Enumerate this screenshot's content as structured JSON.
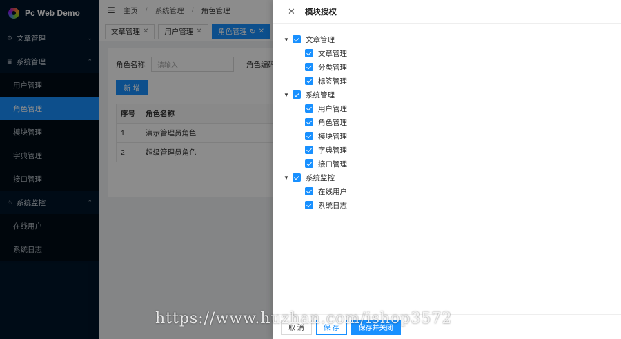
{
  "app": {
    "title": "Pc Web Demo"
  },
  "sidebar": {
    "groups": [
      {
        "label": "文章管理",
        "icon": "article-icon",
        "expanded": false,
        "items": []
      },
      {
        "label": "系统管理",
        "icon": "settings-icon",
        "expanded": true,
        "items": [
          {
            "label": "用户管理",
            "active": false
          },
          {
            "label": "角色管理",
            "active": true
          },
          {
            "label": "模块管理",
            "active": false
          },
          {
            "label": "字典管理",
            "active": false
          },
          {
            "label": "接口管理",
            "active": false
          }
        ]
      },
      {
        "label": "系统监控",
        "icon": "monitor-icon",
        "expanded": true,
        "items": [
          {
            "label": "在线用户",
            "active": false
          },
          {
            "label": "系统日志",
            "active": false
          }
        ]
      }
    ]
  },
  "header": {
    "breadcrumb": [
      "主页",
      "系统管理",
      "角色管理"
    ]
  },
  "tabs": [
    {
      "label": "文章管理",
      "active": false
    },
    {
      "label": "用户管理",
      "active": false
    },
    {
      "label": "角色管理",
      "active": true
    }
  ],
  "search": {
    "role_name_label": "角色名称:",
    "role_name_placeholder": "请输入",
    "role_code_label": "角色编码:"
  },
  "add_button": "新 增",
  "table": {
    "columns": [
      "序号",
      "角色名称"
    ],
    "rows": [
      [
        "1",
        "演示管理员角色"
      ],
      [
        "2",
        "超级管理员角色"
      ]
    ]
  },
  "drawer": {
    "title": "模块授权",
    "tree": [
      {
        "label": "文章管理",
        "children": [
          "文章管理",
          "分类管理",
          "标签管理"
        ]
      },
      {
        "label": "系统管理",
        "children": [
          "用户管理",
          "角色管理",
          "模块管理",
          "字典管理",
          "接口管理"
        ]
      },
      {
        "label": "系统监控",
        "children": [
          "在线用户",
          "系统日志"
        ]
      }
    ],
    "buttons": {
      "cancel": "取 消",
      "save": "保 存",
      "save_close": "保存并关闭"
    }
  },
  "watermark": "https://www.huzhan.com/ishop3572",
  "colors": {
    "primary": "#1890ff",
    "sidebar_bg": "#001529"
  }
}
